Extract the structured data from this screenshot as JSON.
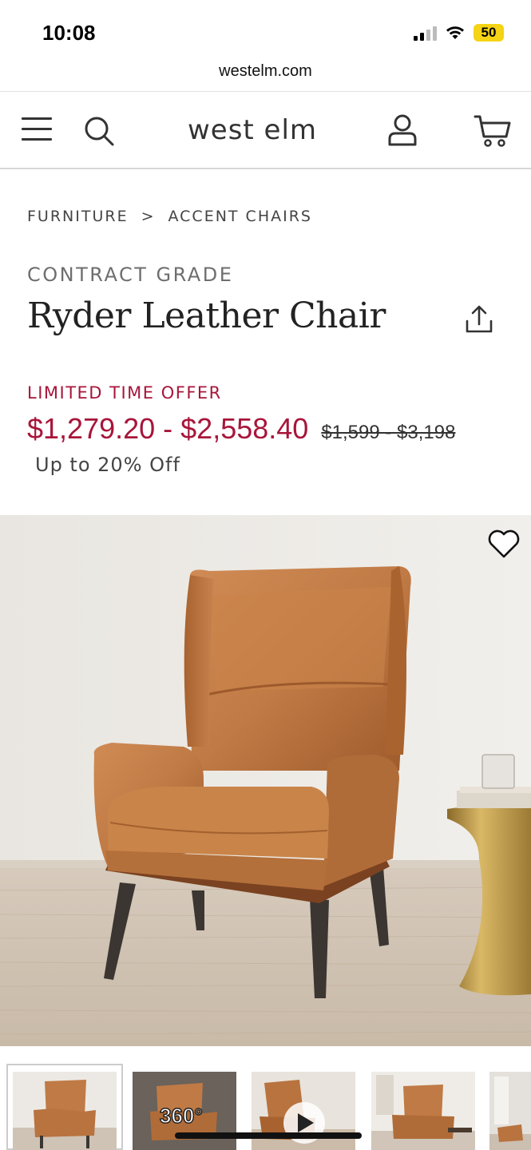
{
  "status_bar": {
    "time": "10:08",
    "battery": "50"
  },
  "browser": {
    "url": "westelm.com"
  },
  "header": {
    "brand": "west elm",
    "icons": [
      "menu-icon",
      "search-icon",
      "account-icon",
      "cart-icon"
    ]
  },
  "breadcrumb": {
    "items": [
      "FURNITURE",
      "ACCENT CHAIRS"
    ],
    "separator": ">"
  },
  "product": {
    "grade": "CONTRACT GRADE",
    "title": "Ryder Leather Chair",
    "offer_label": "LIMITED TIME OFFER",
    "sale_price": "$1,279.20 - $2,558.40",
    "original_price": "$1,599 - $3,198",
    "discount": "Up to 20% Off"
  },
  "colors": {
    "sale_red": "#a8153a",
    "leather": "#c07a45",
    "battery": "#f5d315"
  },
  "thumbnails": {
    "count_visible": 5,
    "badge_360": "360°",
    "items": [
      "thumb-chair-front",
      "thumb-360-view",
      "thumb-video",
      "thumb-room-scene",
      "thumb-room-partial"
    ]
  }
}
